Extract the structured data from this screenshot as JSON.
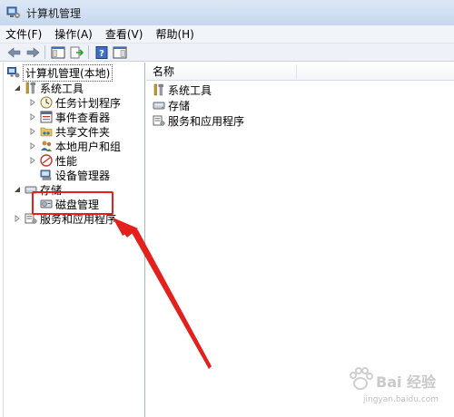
{
  "window": {
    "title": "计算机管理"
  },
  "menu": {
    "file": "文件(F)",
    "action": "操作(A)",
    "view": "查看(V)",
    "help": "帮助(H)"
  },
  "toolbar": {
    "buttons": [
      "back-icon",
      "forward-icon",
      "show-hide-tree-icon",
      "export-list-icon",
      "help-icon",
      "show-hide-action-icon"
    ]
  },
  "tree": {
    "root": "计算机管理(本地)",
    "system_tools": "系统工具",
    "task_scheduler": "任务计划程序",
    "event_viewer": "事件查看器",
    "shared_folders": "共享文件夹",
    "local_users_groups": "本地用户和组",
    "performance": "性能",
    "device_manager": "设备管理器",
    "storage": "存储",
    "disk_management": "磁盘管理",
    "services_apps": "服务和应用程序"
  },
  "list": {
    "column_name": "名称",
    "items": [
      "系统工具",
      "存储",
      "服务和应用程序"
    ]
  },
  "annotation": {
    "highlight_color": "#e3201b"
  },
  "watermark": {
    "brand": "Bai 经验",
    "url": "jingyan.baidu.com"
  }
}
